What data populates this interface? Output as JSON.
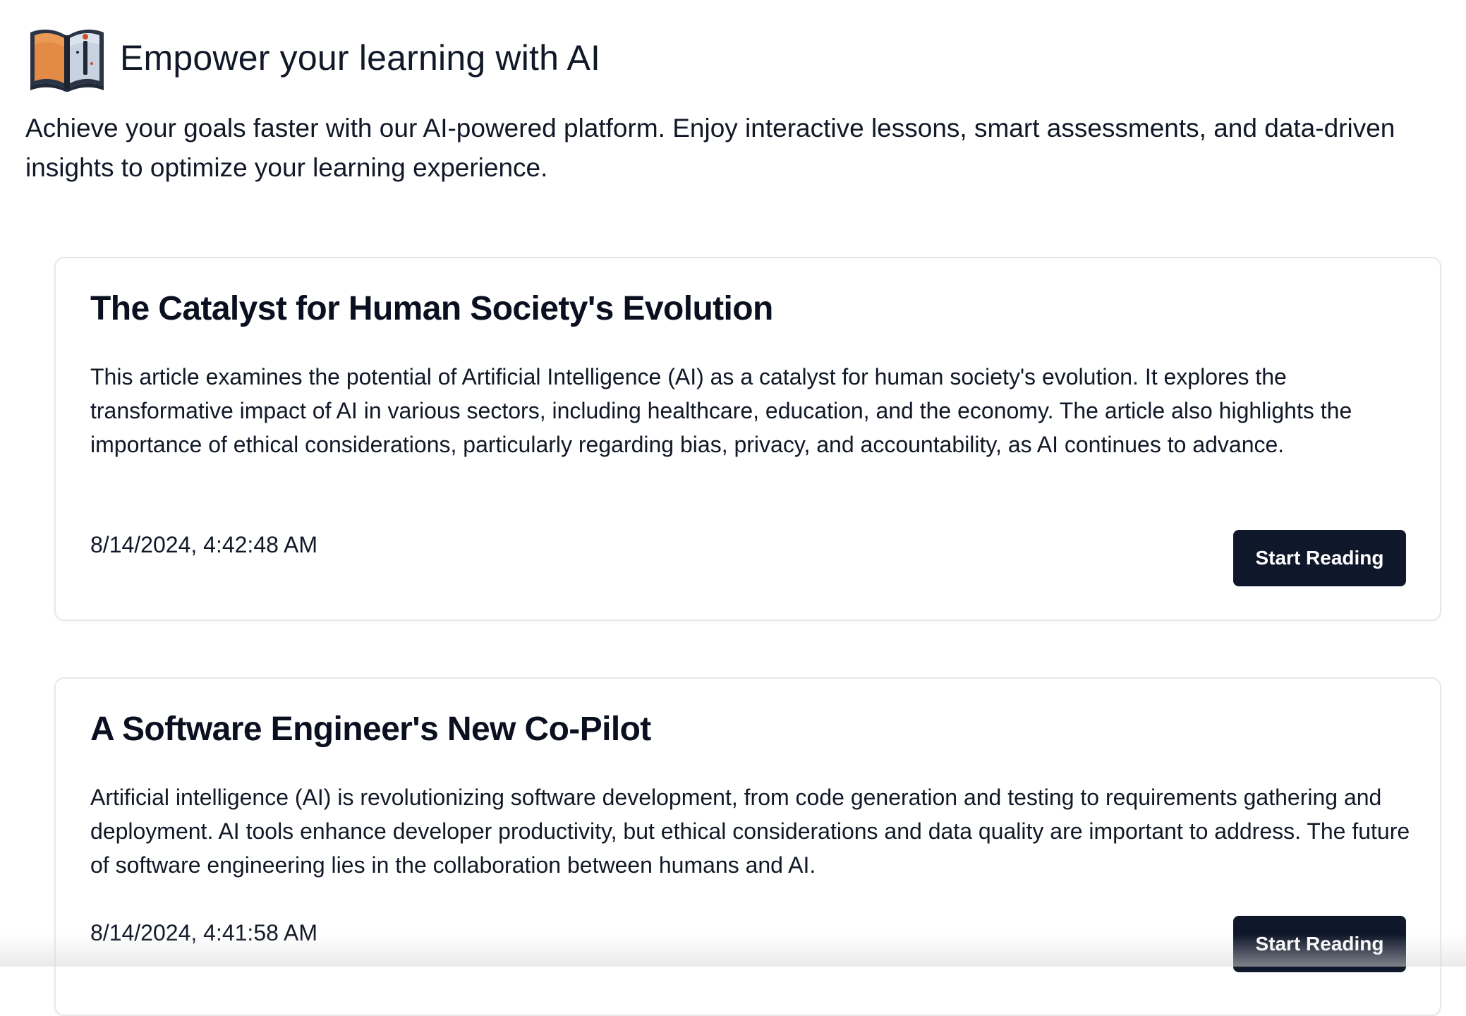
{
  "header": {
    "icon_name": "open-book-icon",
    "title": "Empower your learning with AI",
    "subtitle": "Achieve your goals faster with our AI-powered platform. Enjoy interactive lessons, smart assessments, and data-driven insights to optimize your learning experience."
  },
  "articles": [
    {
      "title": "The Catalyst for Human Society's Evolution",
      "summary": "This article examines the potential of Artificial Intelligence (AI) as a catalyst for human society's evolution. It explores the transformative impact of AI in various sectors, including healthcare, education, and the economy. The article also highlights the importance of ethical considerations, particularly regarding bias, privacy, and accountability, as AI continues to advance.",
      "date": "8/14/2024, 4:42:48 AM",
      "button_label": "Start Reading"
    },
    {
      "title": "A Software Engineer's New Co-Pilot",
      "summary": "Artificial intelligence (AI) is revolutionizing software development, from code generation and testing to requirements gathering and deployment. AI tools enhance developer productivity, but ethical considerations and data quality are important to address. The future of software engineering lies in the collaboration between humans and AI.",
      "date": "8/14/2024, 4:41:58 AM",
      "button_label": "Start Reading"
    }
  ],
  "colors": {
    "button_background": "#0f172a",
    "card_border": "#e7e8ec",
    "text_primary": "#111827"
  }
}
